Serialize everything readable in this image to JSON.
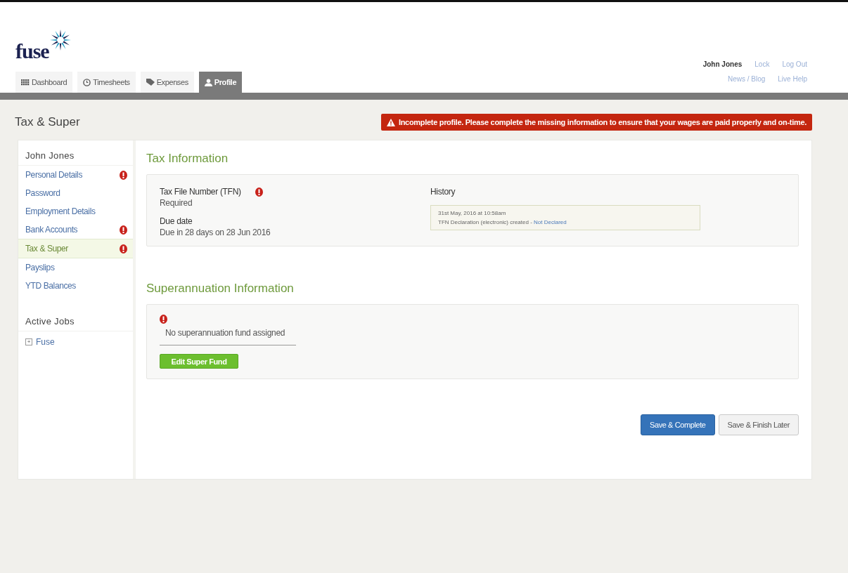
{
  "logo": {
    "text": "fuse"
  },
  "user_menu": {
    "name": "John Jones",
    "links": [
      "Lock",
      "Log Out"
    ],
    "secondary_links": [
      "News / Blog",
      "Live Help"
    ]
  },
  "tabs": [
    {
      "label": "Dashboard",
      "kind": "dashboard",
      "selected": false
    },
    {
      "label": "Timesheets",
      "kind": "timesheets",
      "selected": false
    },
    {
      "label": "Expenses",
      "kind": "expenses",
      "selected": false
    },
    {
      "label": "Profile",
      "kind": "profile",
      "selected": true
    }
  ],
  "page_title": "Tax & Super",
  "alert": {
    "text": "Incomplete profile. Please complete the missing information to ensure that your wages are paid properly and on-time."
  },
  "sidebar": {
    "heading": "John Jones",
    "items": [
      {
        "label": "Personal Details",
        "selected": false,
        "warning": true
      },
      {
        "label": "Password",
        "selected": false,
        "warning": false
      },
      {
        "label": "Employment Details",
        "selected": false,
        "warning": false
      },
      {
        "label": "Bank Accounts",
        "selected": false,
        "warning": true
      },
      {
        "label": "Tax & Super",
        "selected": true,
        "warning": true
      },
      {
        "label": "Payslips",
        "selected": false,
        "warning": false
      },
      {
        "label": "YTD Balances",
        "selected": false,
        "warning": false
      }
    ],
    "jobs_heading": "Active Jobs",
    "jobs": [
      {
        "label": "Fuse",
        "expander": "+",
        "expanded": false
      }
    ]
  },
  "tax": {
    "title": "Tax Information",
    "tfn_label": "Tax File Number (TFN)",
    "tfn_warning": true,
    "tfn_value": "Required",
    "due_label": "Due date",
    "due_value": "Due in 28 days on 28 Jun 2016",
    "history_label": "History",
    "history": [
      {
        "date": "31st May, 2016 at 10:58am",
        "text": "TFN Declaration (electronic) created - ",
        "link": "Not Declared"
      }
    ]
  },
  "super": {
    "title": "Superannuation Information",
    "warning": true,
    "message": "No superannuation fund assigned",
    "button": "Edit Super Fund"
  },
  "buttons": [
    {
      "label": "Save & Complete",
      "kind": "primary"
    },
    {
      "label": "Save & Finish Later",
      "kind": "default"
    }
  ]
}
